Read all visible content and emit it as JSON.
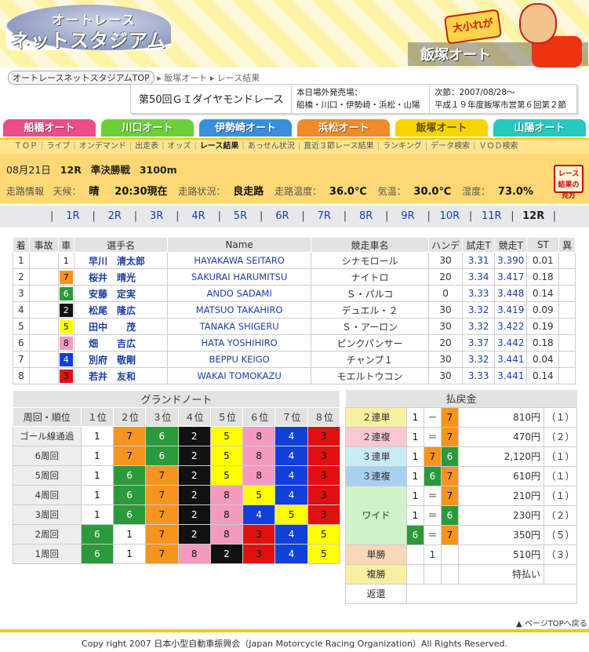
{
  "header": {
    "logo_line1": "オートレース",
    "logo_line2": "ネットスタジアム",
    "venue": "飯塚オート",
    "mascot_tag": "大小れが"
  },
  "breadcrumb": [
    "オートレースネットスタジアムTOP",
    "飯塚オート",
    "レース結果"
  ],
  "info": {
    "title": "第50回ＧＩダイヤモンドレース",
    "offsite_label": "本日場外発売場：",
    "offsite_venues": "船橋・川口・伊勢崎・浜松・山陽",
    "next_label": "次節：2007/08/28～",
    "next_event": "平成１９年度飯塚市営第６回第２節"
  },
  "venue_tabs": [
    {
      "label": "船橋オート",
      "color": "#ee4c88"
    },
    {
      "label": "川口オート",
      "color": "#6ccf3a"
    },
    {
      "label": "伊勢崎オート",
      "color": "#3a8fdc"
    },
    {
      "label": "浜松オート",
      "color": "#f08a2a"
    },
    {
      "label": "飯塚オート",
      "color": "#f6d400"
    },
    {
      "label": "山陽オート",
      "color": "#26c9c0"
    }
  ],
  "subnav": [
    "ＴＯＰ",
    "ライブ",
    "オンデマンド",
    "出走表",
    "オッズ",
    "レース結果",
    "あっせん状況",
    "直近３節レース結果",
    "ランキング",
    "データ検索",
    "ＶＯＤ検索"
  ],
  "subnav_current": "レース結果",
  "race": {
    "date": "08月21日",
    "race_no": "12R",
    "race_type": "準決勝戦",
    "distance": "3100m",
    "track_label": "走路情報",
    "weather_label": "天候：",
    "weather": "晴",
    "time": "20:30現在",
    "cond_label": "走路状況：",
    "cond": "良走路",
    "temp_label": "走路温度：",
    "temp": "36.0℃",
    "air_label": "気温：",
    "air": "30.0℃",
    "hum_label": "湿度：",
    "hum": "73.0%",
    "guide_button": "レース結果の見方"
  },
  "race_nav": [
    "1R",
    "2R",
    "3R",
    "4R",
    "5R",
    "6R",
    "7R",
    "8R",
    "9R",
    "10R",
    "11R",
    "12R"
  ],
  "race_nav_current": "12R",
  "results": {
    "headers": [
      "着",
      "事故",
      "車",
      "選手名",
      "Name",
      "競走車名",
      "ハンデ",
      "試走T",
      "競走T",
      "ST",
      "異"
    ],
    "rows": [
      {
        "pos": "1",
        "acc": "",
        "car": "1",
        "name": "早川　清太郎",
        "en": "HAYAKAWA SEITARO",
        "bike": "シナモロール",
        "hd": "30",
        "trial": "3.31",
        "race": "3.390",
        "st": "0.01",
        "ab": ""
      },
      {
        "pos": "2",
        "acc": "",
        "car": "7",
        "name": "桜井　晴光",
        "en": "SAKURAI HARUMITSU",
        "bike": "ナイトロ",
        "hd": "20",
        "trial": "3.34",
        "race": "3.417",
        "st": "0.18",
        "ab": ""
      },
      {
        "pos": "3",
        "acc": "",
        "car": "6",
        "name": "安藤　定実",
        "en": "ANDO SADAMI",
        "bike": "Ｓ・パルコ",
        "hd": "0",
        "trial": "3.33",
        "race": "3.448",
        "st": "0.14",
        "ab": ""
      },
      {
        "pos": "4",
        "acc": "",
        "car": "2",
        "name": "松尾　隆広",
        "en": "MATSUO TAKAHIRO",
        "bike": "デュエル・２",
        "hd": "30",
        "trial": "3.32",
        "race": "3.419",
        "st": "0.09",
        "ab": ""
      },
      {
        "pos": "5",
        "acc": "",
        "car": "5",
        "name": "田中　　茂",
        "en": "TANAKA SHIGERU",
        "bike": "Ｓ・アーロン",
        "hd": "30",
        "trial": "3.32",
        "race": "3.422",
        "st": "0.19",
        "ab": ""
      },
      {
        "pos": "6",
        "acc": "",
        "car": "8",
        "name": "畑　　吉広",
        "en": "HATA YOSHIHIRO",
        "bike": "ピンクパンサー",
        "hd": "20",
        "trial": "3.37",
        "race": "3.442",
        "st": "0.18",
        "ab": ""
      },
      {
        "pos": "7",
        "acc": "",
        "car": "4",
        "name": "別府　敬剛",
        "en": "BEPPU KEIGO",
        "bike": "チャンプ１",
        "hd": "30",
        "trial": "3.32",
        "race": "3.441",
        "st": "0.04",
        "ab": ""
      },
      {
        "pos": "8",
        "acc": "",
        "car": "3",
        "name": "若井　友和",
        "en": "WAKAI TOMOKAZU",
        "bike": "モエルトウコン",
        "hd": "30",
        "trial": "3.33",
        "race": "3.441",
        "st": "0.14",
        "ab": ""
      }
    ]
  },
  "grand_note": {
    "caption": "グランドノート",
    "headers": [
      "周回・順位",
      "１位",
      "２位",
      "３位",
      "４位",
      "５位",
      "６位",
      "７位",
      "８位"
    ],
    "rows": [
      {
        "lap": "ゴール線通過",
        "cars": [
          "1",
          "7",
          "6",
          "2",
          "5",
          "8",
          "4",
          "3"
        ]
      },
      {
        "lap": "6周回",
        "cars": [
          "1",
          "7",
          "6",
          "2",
          "5",
          "8",
          "4",
          "3"
        ]
      },
      {
        "lap": "5周回",
        "cars": [
          "1",
          "6",
          "7",
          "2",
          "5",
          "8",
          "4",
          "3"
        ]
      },
      {
        "lap": "4周回",
        "cars": [
          "1",
          "6",
          "7",
          "2",
          "8",
          "5",
          "4",
          "3"
        ]
      },
      {
        "lap": "3周回",
        "cars": [
          "1",
          "6",
          "7",
          "2",
          "8",
          "4",
          "5",
          "3"
        ]
      },
      {
        "lap": "2周回",
        "cars": [
          "6",
          "1",
          "7",
          "2",
          "8",
          "3",
          "4",
          "5"
        ]
      },
      {
        "lap": "1周回",
        "cars": [
          "6",
          "1",
          "7",
          "8",
          "2",
          "3",
          "4",
          "5"
        ]
      }
    ]
  },
  "payout": {
    "caption": "払戻金",
    "rows": [
      {
        "type": "２連単",
        "color": "#f7f0a0",
        "a": "1",
        "op": "－",
        "b": "7",
        "c": "",
        "amt": "810円",
        "pop": "（１）"
      },
      {
        "type": "２連複",
        "color": "#f9c8d0",
        "a": "1",
        "op": "＝",
        "b": "7",
        "c": "",
        "amt": "470円",
        "pop": "（２）"
      },
      {
        "type": "３連単",
        "color": "#c8ecf6",
        "a": "1",
        "op": "",
        "b": "7",
        "c": "6",
        "amt": "2,120円",
        "pop": "（１）"
      },
      {
        "type": "３連複",
        "color": "#a8d0f0",
        "a": "1",
        "op": "",
        "b": "6",
        "c": "7",
        "amt": "610円",
        "pop": "（１）"
      }
    ],
    "wide_label": "ワイド",
    "wide": [
      {
        "a": "1",
        "op": "＝",
        "b": "7",
        "amt": "210円",
        "pop": "（１）"
      },
      {
        "a": "1",
        "op": "＝",
        "b": "6",
        "amt": "230円",
        "pop": "（２）"
      },
      {
        "a": "6",
        "op": "＝",
        "b": "7",
        "amt": "350円",
        "pop": "（５）"
      }
    ],
    "tansho_label": "単勝",
    "tansho_car": "1",
    "tansho_amt": "510円",
    "tansho_pop": "（３）",
    "fukusho_label": "複勝",
    "fukusho_note": "特払い",
    "refund_label": "返還"
  },
  "footer": {
    "pagetop": "ページTOPへ戻る",
    "copyright": "Copy right 2007 日本小型自動車振興会（Japan Motorcycle Racing Organization）All Rights Reserved."
  }
}
